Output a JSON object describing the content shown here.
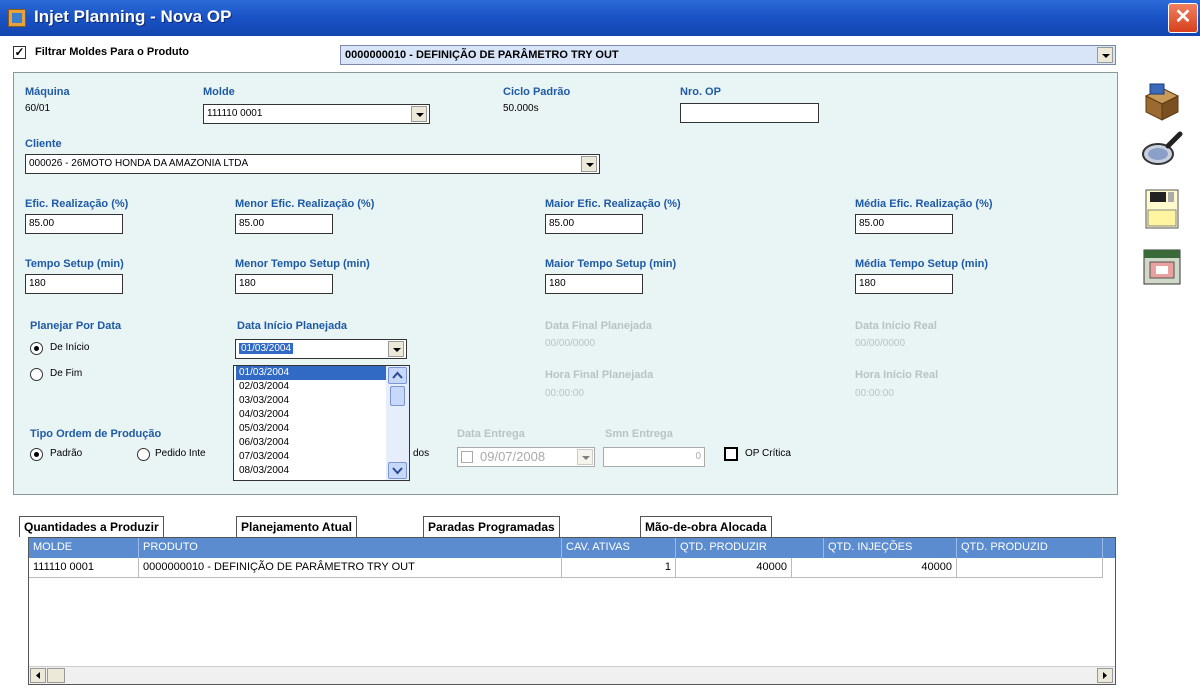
{
  "window": {
    "title": "Injet Planning - Nova OP",
    "close_glyph": "✕"
  },
  "filter": {
    "checked": true,
    "check_glyph": "✓",
    "label": "Filtrar Moldes Para o Produto",
    "product_value": "0000000010 - DEFINIÇÃO DE PARÂMETRO TRY OUT"
  },
  "machine": {
    "label": "Máquina",
    "value": "60/01"
  },
  "mold": {
    "label": "Molde",
    "value": "111110 0001"
  },
  "cycle": {
    "label": "Ciclo Padrão",
    "value": "50.000s"
  },
  "op_number": {
    "label": "Nro. OP",
    "value": ""
  },
  "client": {
    "label": "Cliente",
    "value": "000026 - 26MOTO HONDA DA AMAZONIA LTDA"
  },
  "efficiency": {
    "efic": {
      "label": "Efic. Realização (%)",
      "value": "85.00"
    },
    "menor": {
      "label": "Menor Efic. Realização (%)",
      "value": "85.00"
    },
    "maior": {
      "label": "Maior Efic. Realização (%)",
      "value": "85.00"
    },
    "media": {
      "label": "Média Efic. Realização (%)",
      "value": "85.00"
    }
  },
  "setup": {
    "tempo": {
      "label": "Tempo Setup (min)",
      "value": "180"
    },
    "menor": {
      "label": "Menor Tempo Setup (min)",
      "value": "180"
    },
    "maior": {
      "label": "Maior Tempo Setup (min)",
      "value": "180"
    },
    "media": {
      "label": "Média Tempo Setup (min)",
      "value": "180"
    }
  },
  "planning": {
    "por_data_label": "Planejar Por Data",
    "option_inicio": "De Início",
    "option_fim": "De Fim",
    "selected": "De Início",
    "data_inicio_label": "Data Início Planejada",
    "data_inicio_value": "01/03/2004",
    "data_final_label": "Data Final Planejada",
    "data_final_value": "00/00/0000",
    "hora_final_label": "Hora Final Planejada",
    "hora_final_value": "00:00:00",
    "data_inicio_real_label": "Data Início Real",
    "data_inicio_real_value": "00/00/0000",
    "hora_inicio_real_label": "Hora Início Real",
    "hora_inicio_real_value": "00:00:00",
    "date_options": [
      "01/03/2004",
      "02/03/2004",
      "03/03/2004",
      "04/03/2004",
      "05/03/2004",
      "06/03/2004",
      "07/03/2004",
      "08/03/2004"
    ]
  },
  "order_type": {
    "label": "Tipo Ordem de Produção",
    "option_padrao": "Padrão",
    "option_pedido": "Pedido Inte",
    "partial_text": "dos",
    "selected": "Padrão",
    "data_entrega_label": "Data Entrega",
    "data_entrega_value": "09/07/2008",
    "smn_entrega_label": "Smn Entrega",
    "smn_entrega_value": "0",
    "op_critica_label": "OP Crítica",
    "op_critica_checked": false
  },
  "side_toolbar": [
    "box-icon",
    "magnifier-icon",
    "save-icon",
    "calendar-icon"
  ],
  "tabs": [
    {
      "label": "Quantidades a Produzir",
      "active": true
    },
    {
      "label": "Planejamento Atual",
      "active": false
    },
    {
      "label": "Paradas Programadas",
      "active": false
    },
    {
      "label": "Mão-de-obra Alocada",
      "active": false
    }
  ],
  "grid": {
    "columns": [
      "MOLDE",
      "PRODUTO",
      "CAV. ATIVAS",
      "QTD. PRODUZIR",
      "QTD. INJEÇÕES",
      "QTD. PRODUZID"
    ],
    "rows": [
      [
        "111110 0001",
        "0000000010 - DEFINIÇÃO DE PARÂMETRO TRY OUT",
        "1",
        "40000",
        "40000",
        ""
      ]
    ]
  },
  "colors": {
    "titlebar": "#1a52c4",
    "panel": "#e9f4f4",
    "label_blue": "#1f5aa6",
    "grid_header": "#5c8cd0",
    "selection": "#316ac5"
  }
}
